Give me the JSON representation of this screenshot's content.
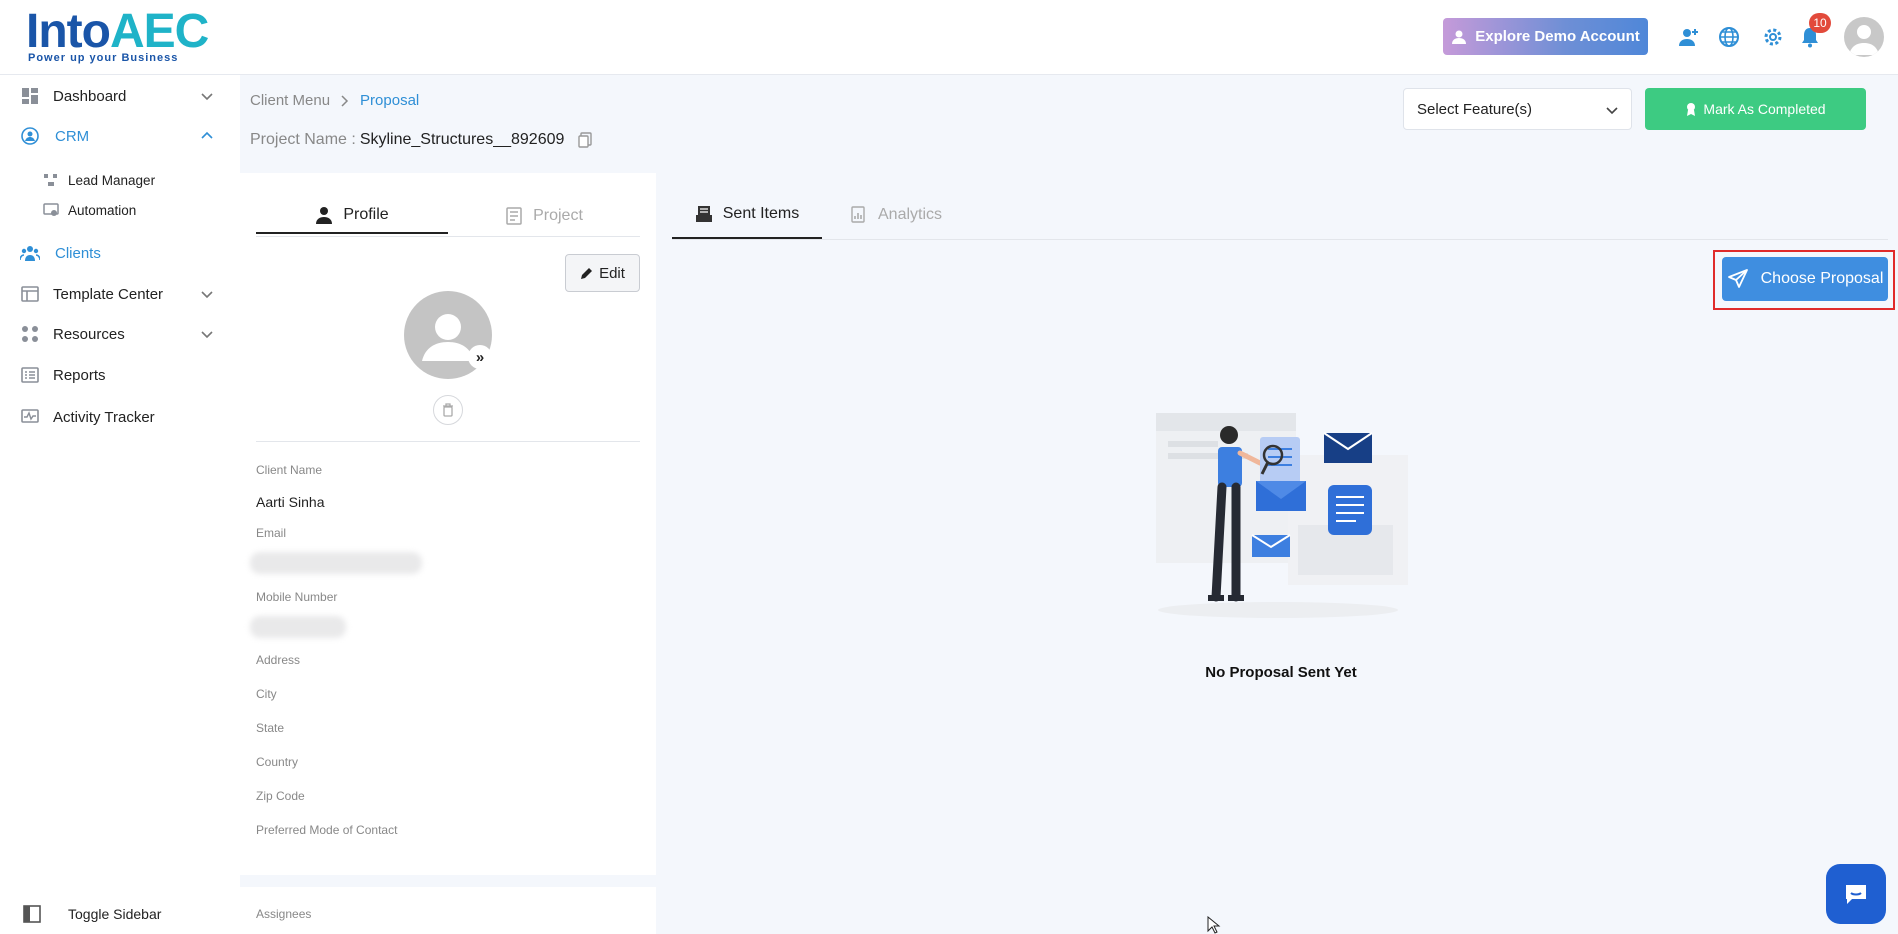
{
  "logo": {
    "text_main": "Into",
    "text_accent": "AEC",
    "tagline": "Power up your Business"
  },
  "header": {
    "explore_label": "Explore Demo Account",
    "notification_count": "10"
  },
  "sidebar": {
    "items": [
      {
        "label": "Dashboard"
      },
      {
        "label": "CRM"
      },
      {
        "label": "Lead Manager"
      },
      {
        "label": "Automation"
      },
      {
        "label": "Clients"
      },
      {
        "label": "Template Center"
      },
      {
        "label": "Resources"
      },
      {
        "label": "Reports"
      },
      {
        "label": "Activity Tracker"
      }
    ],
    "toggle_label": "Toggle Sidebar"
  },
  "breadcrumb": {
    "parent": "Client Menu",
    "current": "Proposal"
  },
  "project": {
    "label": "Project Name :",
    "value": "Skyline_Structures__892609"
  },
  "toolbar": {
    "select_feature": "Select Feature(s)",
    "mark_completed": "Mark As Completed"
  },
  "profile": {
    "tabs": [
      {
        "label": "Profile"
      },
      {
        "label": "Project"
      }
    ],
    "edit_label": "Edit",
    "fields": {
      "client_name_label": "Client Name",
      "client_name_value": "Aarti Sinha",
      "email_label": "Email",
      "mobile_label": "Mobile Number",
      "address_label": "Address",
      "city_label": "City",
      "state_label": "State",
      "country_label": "Country",
      "zip_label": "Zip Code",
      "contact_mode_label": "Preferred Mode of Contact"
    },
    "assignees_label": "Assignees"
  },
  "proposal": {
    "tabs": [
      {
        "label": "Sent Items"
      },
      {
        "label": "Analytics"
      }
    ],
    "choose_label": "Choose Proposal",
    "empty_message": "No Proposal Sent Yet"
  },
  "colors": {
    "accent": "#2f8fd6",
    "green": "#3dcb82",
    "highlight": "#e02b2b"
  }
}
